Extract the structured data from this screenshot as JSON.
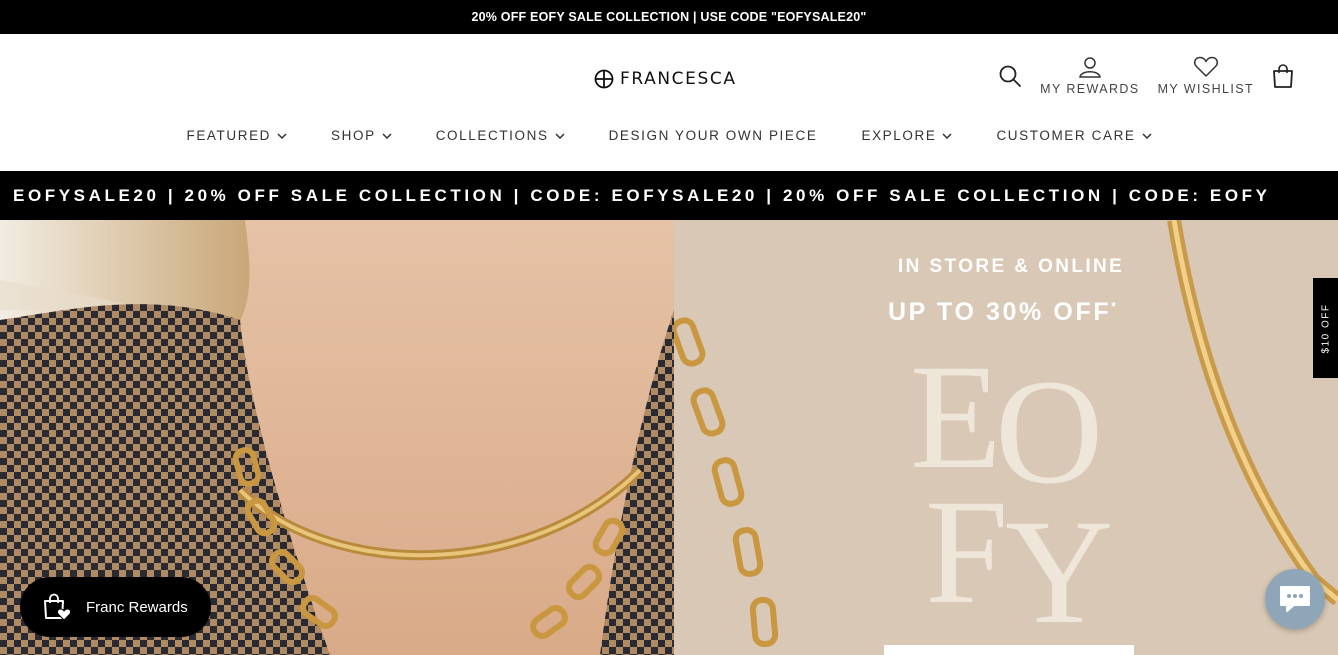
{
  "announcement": {
    "text": "20% OFF EOFY SALE COLLECTION | USE CODE \"EOFYSALE20\""
  },
  "brand": {
    "name": "FRANCESCA"
  },
  "utility": {
    "rewards_label": "MY REWARDS",
    "wishlist_label": "MY WISHLIST"
  },
  "nav": {
    "items": [
      {
        "label": "FEATURED",
        "has_dropdown": true
      },
      {
        "label": "SHOP",
        "has_dropdown": true
      },
      {
        "label": "COLLECTIONS",
        "has_dropdown": true
      },
      {
        "label": "DESIGN YOUR OWN PIECE",
        "has_dropdown": false
      },
      {
        "label": "EXPLORE",
        "has_dropdown": true
      },
      {
        "label": "CUSTOMER CARE",
        "has_dropdown": true
      }
    ]
  },
  "marquee": {
    "text": "EOFYSALE20 | 20% OFF SALE COLLECTION | CODE: EOFYSALE20 | 20% OFF SALE COLLECTION | CODE: EOFY"
  },
  "hero": {
    "line1": "IN STORE & ONLINE",
    "line2": "UP TO 30% OFF",
    "line2_mark": "*",
    "big_letters": [
      "E",
      "O",
      "F",
      "Y"
    ]
  },
  "side_tab": {
    "label": "$10 OFF"
  },
  "rewards_button": {
    "label": "Franc Rewards"
  },
  "icons": {
    "logo": "globe-logo-icon",
    "search": "search-icon",
    "rewards": "user-icon",
    "wishlist": "heart-icon",
    "cart": "shopping-bag-icon",
    "dropdown": "chevron-down-icon",
    "rewards_button": "gift-bag-icon",
    "chat": "chat-bubble-icon"
  },
  "colors": {
    "announcement_bg": "#000000",
    "marquee_bg": "#000000",
    "hero_right_bg": "#d8c8b5",
    "rewards_bg": "#000000",
    "chat_bg": "#8fa6b8"
  }
}
